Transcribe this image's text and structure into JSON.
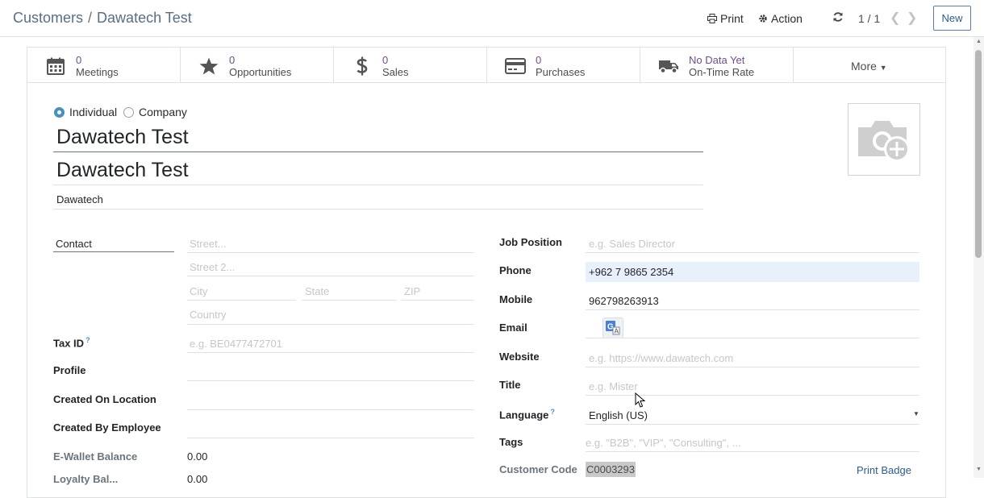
{
  "breadcrumb": {
    "parent": "Customers",
    "separator": "/",
    "current": "Dawatech Test"
  },
  "toolbar": {
    "print": "Print",
    "action": "Action",
    "pager": "1 / 1",
    "new": "New"
  },
  "stats": [
    {
      "value": "0",
      "label": "Meetings",
      "icon": "calendar-icon"
    },
    {
      "value": "0",
      "label": "Opportunities",
      "icon": "star-icon"
    },
    {
      "value": "0",
      "label": "Sales",
      "icon": "dollar-icon"
    },
    {
      "value": "0",
      "label": "Purchases",
      "icon": "credit-card-icon"
    },
    {
      "value": "No Data Yet",
      "label": "On-Time Rate",
      "icon": "truck-icon"
    }
  ],
  "more": "More",
  "type": {
    "individual": "Individual",
    "company": "Company",
    "selected": "Individual"
  },
  "name": "Dawatech Test",
  "display_name": "Dawatech Test",
  "company_name": "Dawatech",
  "address": {
    "type": "Contact",
    "street_ph": "Street...",
    "street2_ph": "Street 2...",
    "city_ph": "City",
    "state_ph": "State",
    "zip_ph": "ZIP",
    "country_ph": "Country"
  },
  "left_fields": {
    "tax_id": "Tax ID",
    "tax_id_help": "?",
    "tax_id_ph": "e.g. BE0477472701",
    "profile": "Profile",
    "created_on_location": "Created On Location",
    "created_by_employee": "Created By Employee",
    "ewallet_label": "E-Wallet Balance",
    "ewallet_value": "0.00",
    "loyalty_label": "Loyalty Bal...",
    "loyalty_value": "0.00"
  },
  "right_fields": {
    "job_position": "Job Position",
    "job_position_ph": "e.g. Sales Director",
    "phone": "Phone",
    "phone_value": "+962 7 9865 2354",
    "mobile": "Mobile",
    "mobile_value": "962798263913",
    "email": "Email",
    "website": "Website",
    "website_ph": "e.g. https://www.dawatech.com",
    "title": "Title",
    "title_ph": "e.g. Mister",
    "language": "Language",
    "language_help": "?",
    "language_value": "English (US)",
    "tags": "Tags",
    "tags_ph": "e.g. \"B2B\", \"VIP\", \"Consulting\", ...",
    "customer_code": "Customer Code",
    "customer_code_value": "C0003293",
    "print_badge": "Print Badge"
  }
}
